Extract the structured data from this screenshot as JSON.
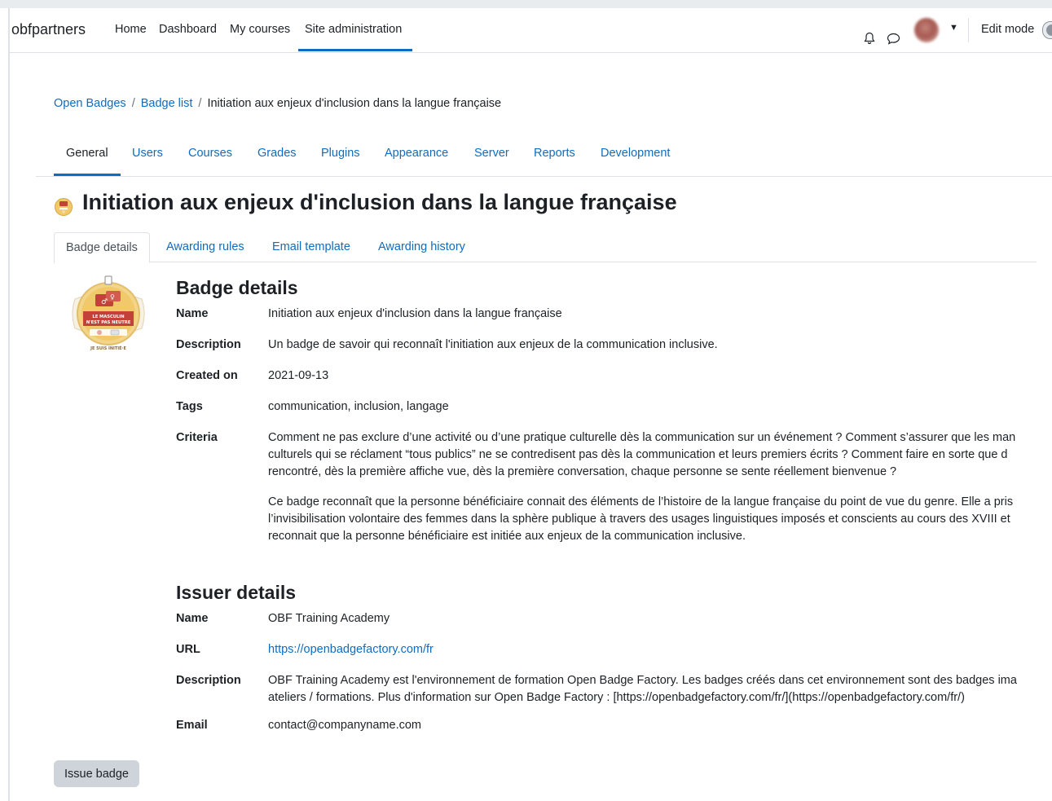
{
  "navbar": {
    "brand": "obfpartners",
    "links": [
      "Home",
      "Dashboard",
      "My courses",
      "Site administration"
    ],
    "active_link": "Site administration",
    "edit_mode_label": "Edit mode"
  },
  "breadcrumb": {
    "items": [
      "Open Badges",
      "Badge list",
      "Initiation aux enjeux d'inclusion dans la langue française"
    ]
  },
  "secondary_nav": {
    "items": [
      "General",
      "Users",
      "Courses",
      "Grades",
      "Plugins",
      "Appearance",
      "Server",
      "Reports",
      "Development"
    ],
    "active": "General"
  },
  "page_title": "Initiation aux enjeux d'inclusion dans la langue française",
  "tabs": {
    "items": [
      "Badge details",
      "Awarding rules",
      "Email template",
      "Awarding history"
    ],
    "active": "Badge details"
  },
  "badge_details": {
    "title": "Badge details",
    "name_label": "Name",
    "name": "Initiation aux enjeux d'inclusion dans la langue française",
    "description_label": "Description",
    "description": "Un badge de savoir qui reconnaît l'initiation aux enjeux de la communication inclusive.",
    "created_label": "Created on",
    "created": "2021-09-13",
    "tags_label": "Tags",
    "tags": "communication, inclusion, langage",
    "criteria_label": "Criteria",
    "criteria_p1": [
      "Comment ne pas exclure d’une activité ou d’une pratique culturelle dès la communication sur un événement ? Comment s’assurer que les man",
      "culturels qui se réclament “tous publics” ne se contredisent pas dès la communication et leurs premiers écrits ? Comment faire en sorte que d",
      "rencontré, dès la première affiche vue, dès la première conversation, chaque personne se sente réellement bienvenue ?"
    ],
    "criteria_p2": [
      "Ce badge reconnaît que la personne bénéficiaire connait des éléments de l’histoire de la langue française du point de vue du genre. Elle a pris",
      "l’invisibilisation volontaire des femmes dans la sphère publique à travers des usages linguistiques imposés et conscients au cours des XVIII et",
      "reconnait que la personne bénéficiaire est initiée aux enjeux de la communication inclusive."
    ]
  },
  "issuer_details": {
    "title": "Issuer details",
    "name_label": "Name",
    "name": "OBF Training Academy",
    "url_label": "URL",
    "url": "https://openbadgefactory.com/fr",
    "description_label": "Description",
    "description": [
      "OBF Training Academy est l'environnement de formation Open Badge Factory. Les badges créés dans cet environnement sont des badges ima",
      "ateliers / formations. Plus d'information sur Open Badge Factory : [https://openbadgefactory.com/fr/](https://openbadgefactory.com/fr/)"
    ],
    "email_label": "Email",
    "email": "contact@companyname.com"
  },
  "issue_button": "Issue badge",
  "badge_image": {
    "line1": "LE MASCULIN",
    "line2": "N'EST PAS NEUTRE",
    "arc_text": "JE SUIS INITIÉ·E"
  },
  "colors": {
    "link": "#0f6cbf",
    "text": "#1d2125",
    "border": "#dee2e6",
    "badge_gold": "#f1c96b",
    "badge_red": "#c2423a"
  }
}
